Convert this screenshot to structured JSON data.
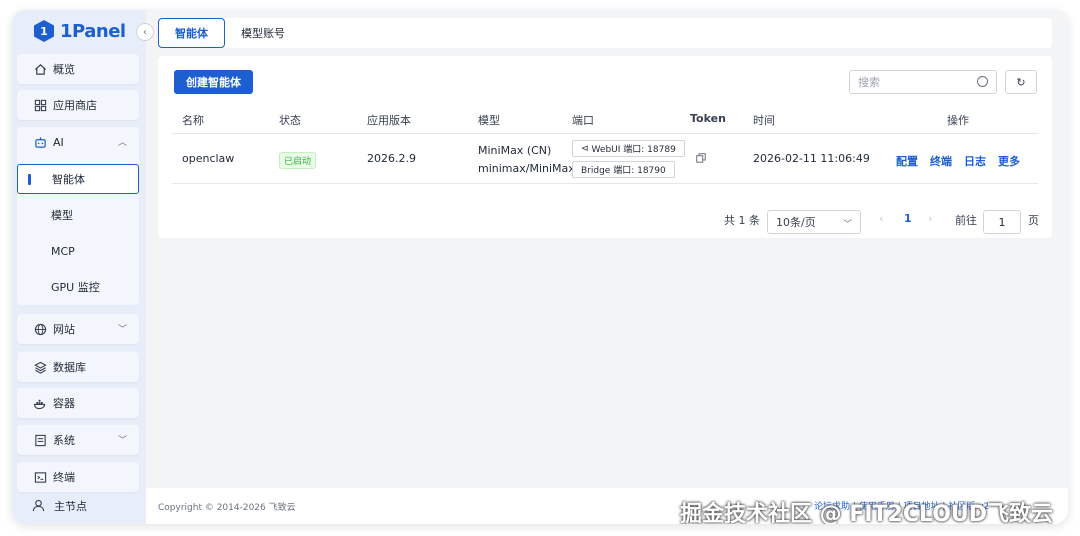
{
  "logo": {
    "text": "1Panel",
    "glyph": "1"
  },
  "sidebar": {
    "items": [
      {
        "label": "概览",
        "icon": "home-icon"
      },
      {
        "label": "应用商店",
        "icon": "grid-icon"
      },
      {
        "label": "AI",
        "icon": "robot-icon"
      },
      {
        "label": "网站",
        "icon": "globe-icon"
      },
      {
        "label": "数据库",
        "icon": "layers-icon"
      },
      {
        "label": "容器",
        "icon": "docker-icon"
      },
      {
        "label": "系统",
        "icon": "system-icon"
      },
      {
        "label": "终端",
        "icon": "terminal-icon"
      }
    ],
    "ai_sub": [
      "智能体",
      "模型",
      "MCP",
      "GPU 监控"
    ],
    "node": "主节点"
  },
  "tabs": [
    "智能体",
    "模型账号"
  ],
  "toolbar": {
    "create_label": "创建智能体",
    "search_placeholder": "搜索"
  },
  "table": {
    "headers": [
      "名称",
      "状态",
      "应用版本",
      "模型",
      "端口",
      "Token",
      "时间",
      "操作"
    ],
    "rows": [
      {
        "name": "openclaw",
        "status": "已启动",
        "version": "2026.2.9",
        "model_line1": "MiniMax (CN)",
        "model_line2": "minimax/MiniMax-",
        "port_webui": "WebUI 端口: 18789",
        "port_bridge": "Bridge 端口: 18790",
        "time": "2026-02-11 11:06:49",
        "actions": [
          "配置",
          "终端",
          "日志",
          "更多"
        ]
      }
    ]
  },
  "pagination": {
    "total": "共 1 条",
    "page_size": "10条/页",
    "current": "1",
    "goto_label": "前往",
    "goto_value": "1",
    "page_unit": "页"
  },
  "footer": {
    "copyright": "Copyright © 2014-2026 飞致云",
    "links": "论坛求助 | 使用手册 | 项目地址 | 社区版 v2"
  },
  "watermark": "掘金技术社区 @ FIT2CLOUD飞致云",
  "colors": {
    "accent": "#1d5fd1",
    "running": "#38b24a"
  }
}
